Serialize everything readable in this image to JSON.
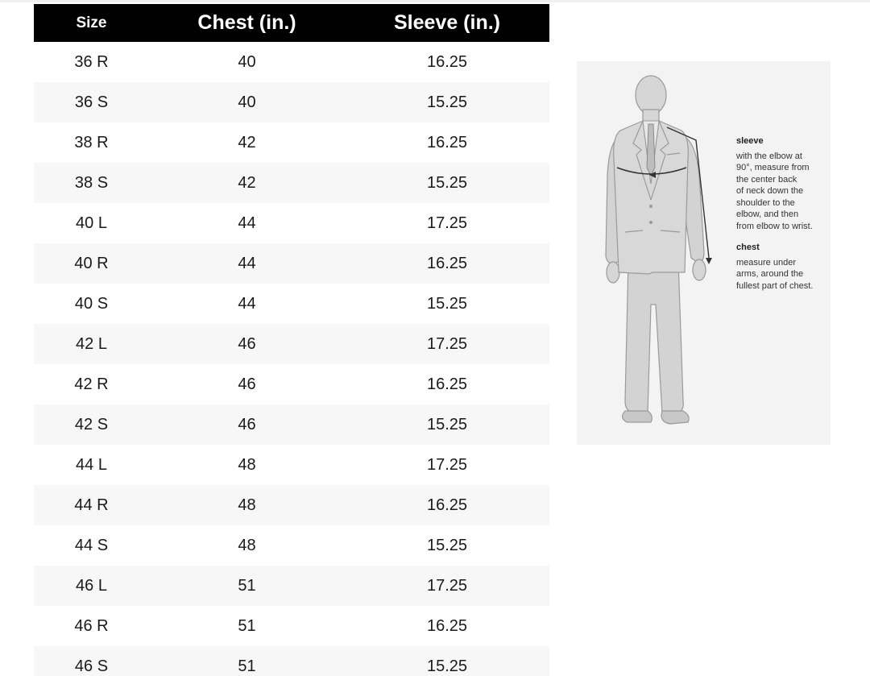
{
  "table": {
    "headers": {
      "size": "Size",
      "chest": "Chest (in.)",
      "sleeve": "Sleeve (in.)"
    },
    "rows": [
      {
        "size": "36 R",
        "chest": "40",
        "sleeve": "16.25"
      },
      {
        "size": "36 S",
        "chest": "40",
        "sleeve": "15.25"
      },
      {
        "size": "38 R",
        "chest": "42",
        "sleeve": "16.25"
      },
      {
        "size": "38 S",
        "chest": "42",
        "sleeve": "15.25"
      },
      {
        "size": "40 L",
        "chest": "44",
        "sleeve": "17.25"
      },
      {
        "size": "40 R",
        "chest": "44",
        "sleeve": "16.25"
      },
      {
        "size": "40 S",
        "chest": "44",
        "sleeve": "15.25"
      },
      {
        "size": "42 L",
        "chest": "46",
        "sleeve": "17.25"
      },
      {
        "size": "42 R",
        "chest": "46",
        "sleeve": "16.25"
      },
      {
        "size": "42 S",
        "chest": "46",
        "sleeve": "15.25"
      },
      {
        "size": "44 L",
        "chest": "48",
        "sleeve": "17.25"
      },
      {
        "size": "44 R",
        "chest": "48",
        "sleeve": "16.25"
      },
      {
        "size": "44 S",
        "chest": "48",
        "sleeve": "15.25"
      },
      {
        "size": "46 L",
        "chest": "51",
        "sleeve": "17.25"
      },
      {
        "size": "46 R",
        "chest": "51",
        "sleeve": "16.25"
      },
      {
        "size": "46 S",
        "chest": "51",
        "sleeve": "15.25"
      }
    ]
  },
  "guide": {
    "sleeve_heading": "sleeve",
    "sleeve_lines": [
      "with the elbow at",
      "90°, measure from",
      "the center back",
      "of neck down the",
      "shoulder to the",
      "elbow, and then",
      "from elbow to wrist."
    ],
    "chest_heading": "chest",
    "chest_lines": [
      "measure under",
      "arms, around the",
      "fullest part of chest."
    ],
    "figure_icon": "suited-man-figure"
  },
  "colors": {
    "header_bg": "#000000",
    "header_text": "#ffffff",
    "row_alt_bg": "#f7f7f7",
    "panel_bg": "#f3f3f3",
    "figure_fill": "#d6d6d6",
    "figure_stroke": "#9a9a9a",
    "measure_line": "#333333"
  }
}
